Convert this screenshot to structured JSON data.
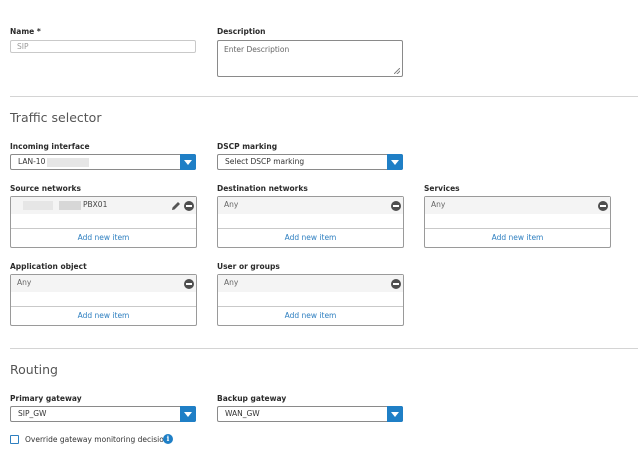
{
  "general": {
    "name_label": "Name *",
    "name_placeholder": "SIP",
    "description_label": "Description",
    "description_placeholder": "Enter Description"
  },
  "traffic_selector": {
    "title": "Traffic selector",
    "incoming_interface_label": "Incoming interface",
    "incoming_interface_value": "LAN-10",
    "dscp_label": "DSCP marking",
    "dscp_value": "Select DSCP marking",
    "source_networks_label": "Source networks",
    "source_networks_item": "PBX01",
    "destination_networks_label": "Destination networks",
    "destination_networks_item": "Any",
    "services_label": "Services",
    "services_item": "Any",
    "application_object_label": "Application object",
    "application_object_item": "Any",
    "users_groups_label": "User or groups",
    "users_groups_item": "Any",
    "add_new_item": "Add new item"
  },
  "routing": {
    "title": "Routing",
    "primary_gateway_label": "Primary gateway",
    "primary_gateway_value": "SIP_GW",
    "backup_gateway_label": "Backup gateway",
    "backup_gateway_value": "WAN_GW",
    "override_label": "Override gateway monitoring decision",
    "override_checked": false
  },
  "icons": {
    "pencil": "pencil-icon",
    "remove": "minus-circle-icon",
    "dropdown": "chevron-down-icon",
    "info": "info-icon"
  },
  "colors": {
    "accent": "#1f7fc6",
    "link": "#2e7fc0",
    "section_text": "#555555",
    "remove_icon": "#4e4e4e"
  }
}
